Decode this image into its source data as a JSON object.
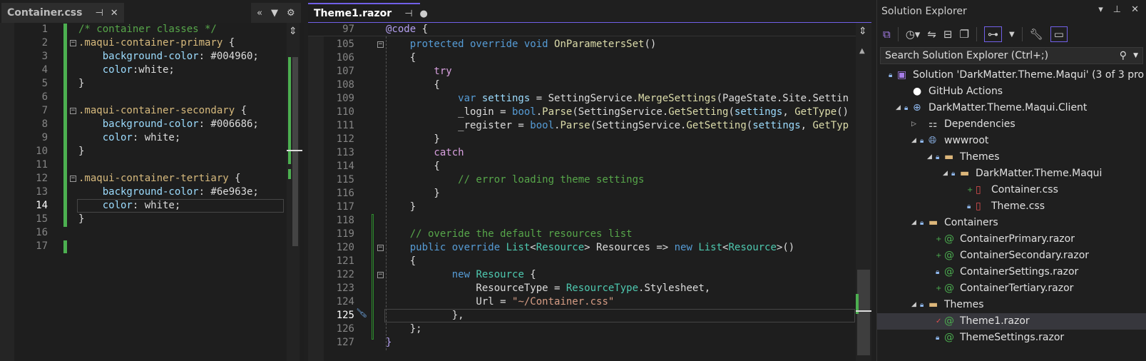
{
  "left_editor": {
    "tab_label": "Container.css",
    "lines": [
      {
        "n": "1",
        "t": [
          [
            "/* container classes */",
            "c-com"
          ]
        ]
      },
      {
        "n": "2",
        "fold": true,
        "t": [
          [
            ".maqui-container-primary",
            "c-sel"
          ],
          [
            " {",
            "c-id"
          ]
        ]
      },
      {
        "n": "3",
        "t": [
          [
            "    background-color",
            "c-prop"
          ],
          [
            ": #004960;",
            "c-val"
          ]
        ]
      },
      {
        "n": "4",
        "t": [
          [
            "    color",
            "c-prop"
          ],
          [
            ":white;",
            "c-val"
          ]
        ]
      },
      {
        "n": "5",
        "t": [
          [
            "}",
            "c-id"
          ]
        ]
      },
      {
        "n": "6",
        "t": []
      },
      {
        "n": "7",
        "fold": true,
        "t": [
          [
            ".maqui-container-secondary",
            "c-sel"
          ],
          [
            " {",
            "c-id"
          ]
        ]
      },
      {
        "n": "8",
        "t": [
          [
            "    background-color",
            "c-prop"
          ],
          [
            ": #006686;",
            "c-val"
          ]
        ]
      },
      {
        "n": "9",
        "t": [
          [
            "    color",
            "c-prop"
          ],
          [
            ": white;",
            "c-val"
          ]
        ]
      },
      {
        "n": "10",
        "t": [
          [
            "}",
            "c-id"
          ]
        ]
      },
      {
        "n": "11",
        "t": []
      },
      {
        "n": "12",
        "fold": true,
        "t": [
          [
            ".maqui-container-tertiary",
            "c-sel"
          ],
          [
            " {",
            "c-id"
          ]
        ]
      },
      {
        "n": "13",
        "t": [
          [
            "    background-color",
            "c-prop"
          ],
          [
            ": #6e963e;",
            "c-val"
          ]
        ]
      },
      {
        "n": "14",
        "cur": true,
        "t": [
          [
            "    color",
            "c-prop"
          ],
          [
            ": white;",
            "c-val"
          ]
        ]
      },
      {
        "n": "15",
        "t": [
          [
            "}",
            "c-id"
          ]
        ]
      },
      {
        "n": "16",
        "t": []
      },
      {
        "n": "17",
        "t": []
      }
    ]
  },
  "center_editor": {
    "tab_label": "Theme1.razor",
    "sticky": {
      "n": "97",
      "t": [
        [
          "@code",
          "c-at"
        ],
        [
          " {",
          "c-id"
        ]
      ]
    },
    "lines": [
      {
        "n": "105",
        "fold": true,
        "t": [
          [
            "    protected override void ",
            "c-kw"
          ],
          [
            "OnParametersSet",
            "c-fn"
          ],
          [
            "()",
            "c-id"
          ]
        ]
      },
      {
        "n": "106",
        "t": [
          [
            "    {",
            "c-id"
          ]
        ]
      },
      {
        "n": "107",
        "t": [
          [
            "        try",
            "c-ctl"
          ]
        ]
      },
      {
        "n": "108",
        "t": [
          [
            "        {",
            "c-id"
          ]
        ]
      },
      {
        "n": "109",
        "t": [
          [
            "            var ",
            "c-kw"
          ],
          [
            "settings",
            "c-var"
          ],
          [
            " = SettingService.",
            "c-id"
          ],
          [
            "MergeSettings",
            "c-fn"
          ],
          [
            "(PageState.Site.Settin",
            "c-id"
          ]
        ]
      },
      {
        "n": "110",
        "t": [
          [
            "            _login = ",
            "c-id"
          ],
          [
            "bool",
            "c-kw"
          ],
          [
            ".",
            "c-id"
          ],
          [
            "Parse",
            "c-fn"
          ],
          [
            "(SettingService.",
            "c-id"
          ],
          [
            "GetSetting",
            "c-fn"
          ],
          [
            "(",
            "c-id"
          ],
          [
            "settings",
            "c-var"
          ],
          [
            ", ",
            "c-id"
          ],
          [
            "GetType",
            "c-fn"
          ],
          [
            "()",
            "c-id"
          ]
        ]
      },
      {
        "n": "111",
        "t": [
          [
            "            _register = ",
            "c-id"
          ],
          [
            "bool",
            "c-kw"
          ],
          [
            ".",
            "c-id"
          ],
          [
            "Parse",
            "c-fn"
          ],
          [
            "(SettingService.",
            "c-id"
          ],
          [
            "GetSetting",
            "c-fn"
          ],
          [
            "(",
            "c-id"
          ],
          [
            "settings",
            "c-var"
          ],
          [
            ", ",
            "c-id"
          ],
          [
            "GetTyp",
            "c-fn"
          ]
        ]
      },
      {
        "n": "112",
        "t": [
          [
            "        }",
            "c-id"
          ]
        ]
      },
      {
        "n": "113",
        "t": [
          [
            "        catch",
            "c-ctl"
          ]
        ]
      },
      {
        "n": "114",
        "t": [
          [
            "        {",
            "c-id"
          ]
        ]
      },
      {
        "n": "115",
        "t": [
          [
            "            // error loading theme settings",
            "c-com"
          ]
        ]
      },
      {
        "n": "116",
        "t": [
          [
            "        }",
            "c-id"
          ]
        ]
      },
      {
        "n": "117",
        "t": [
          [
            "    }",
            "c-id"
          ]
        ]
      },
      {
        "n": "118",
        "t": []
      },
      {
        "n": "119",
        "t": [
          [
            "    // overide the default resources list",
            "c-com"
          ]
        ]
      },
      {
        "n": "120",
        "fold": true,
        "t": [
          [
            "    public override ",
            "c-kw"
          ],
          [
            "List",
            "c-type"
          ],
          [
            "<",
            "c-id"
          ],
          [
            "Resource",
            "c-type"
          ],
          [
            "> Resources => ",
            "c-id"
          ],
          [
            "new ",
            "c-kw"
          ],
          [
            "List",
            "c-type"
          ],
          [
            "<",
            "c-id"
          ],
          [
            "Resource",
            "c-type"
          ],
          [
            ">()",
            "c-id"
          ]
        ]
      },
      {
        "n": "121",
        "t": [
          [
            "    {",
            "c-id"
          ]
        ]
      },
      {
        "n": "122",
        "fold": true,
        "t": [
          [
            "           new ",
            "c-kw"
          ],
          [
            "Resource",
            "c-type"
          ],
          [
            " {",
            "c-id"
          ]
        ]
      },
      {
        "n": "123",
        "t": [
          [
            "               ResourceType = ",
            "c-id"
          ],
          [
            "ResourceType",
            "c-type"
          ],
          [
            ".Stylesheet,",
            "c-id"
          ]
        ]
      },
      {
        "n": "124",
        "t": [
          [
            "               Url = ",
            "c-id"
          ],
          [
            "\"~/Container.css\"",
            "c-str"
          ]
        ]
      },
      {
        "n": "125",
        "cur": true,
        "t": [
          [
            "           },",
            "c-id"
          ]
        ]
      },
      {
        "n": "126",
        "t": [
          [
            "    };",
            "c-id"
          ]
        ]
      },
      {
        "n": "127",
        "t": [
          [
            "}",
            "c-at"
          ]
        ]
      }
    ]
  },
  "solution_explorer": {
    "title": "Solution Explorer",
    "search_placeholder": "Search Solution Explorer (Ctrl+;)",
    "items": [
      {
        "label": "Solution 'DarkMatter.Theme.Maqui' (3 of 3 pro",
        "lvl": 0,
        "state": "lock",
        "icon": "solution",
        "exp": ""
      },
      {
        "label": "GitHub Actions",
        "lvl": 1,
        "state": "",
        "icon": "github",
        "exp": ""
      },
      {
        "label": "DarkMatter.Theme.Maqui.Client",
        "lvl": 1,
        "state": "lock",
        "icon": "project",
        "exp": "open"
      },
      {
        "label": "Dependencies",
        "lvl": 2,
        "state": "",
        "icon": "deps",
        "exp": "closed"
      },
      {
        "label": "wwwroot",
        "lvl": 2,
        "state": "lock",
        "icon": "globe",
        "exp": "open"
      },
      {
        "label": "Themes",
        "lvl": 3,
        "state": "lock",
        "icon": "folder",
        "exp": "open"
      },
      {
        "label": "DarkMatter.Theme.Maqui",
        "lvl": 4,
        "state": "lock",
        "icon": "folder",
        "exp": "open"
      },
      {
        "label": "Container.css",
        "lvl": 5,
        "state": "plus",
        "icon": "css",
        "exp": ""
      },
      {
        "label": "Theme.css",
        "lvl": 5,
        "state": "lock",
        "icon": "css",
        "exp": ""
      },
      {
        "label": "Containers",
        "lvl": 2,
        "state": "lock",
        "icon": "folder",
        "exp": "open"
      },
      {
        "label": "ContainerPrimary.razor",
        "lvl": 3,
        "state": "plus",
        "icon": "razor",
        "exp": ""
      },
      {
        "label": "ContainerSecondary.razor",
        "lvl": 3,
        "state": "plus",
        "icon": "razor",
        "exp": ""
      },
      {
        "label": "ContainerSettings.razor",
        "lvl": 3,
        "state": "lock",
        "icon": "razor",
        "exp": ""
      },
      {
        "label": "ContainerTertiary.razor",
        "lvl": 3,
        "state": "plus",
        "icon": "razor",
        "exp": ""
      },
      {
        "label": "Themes",
        "lvl": 2,
        "state": "lock",
        "icon": "folder",
        "exp": "open"
      },
      {
        "label": "Theme1.razor",
        "lvl": 3,
        "state": "check",
        "icon": "razor",
        "exp": "",
        "selected": true
      },
      {
        "label": "ThemeSettings.razor",
        "lvl": 3,
        "state": "lock",
        "icon": "razor",
        "exp": ""
      }
    ]
  },
  "colors": {
    "accent": "#7160e8",
    "change_bar": "#4caf50"
  }
}
